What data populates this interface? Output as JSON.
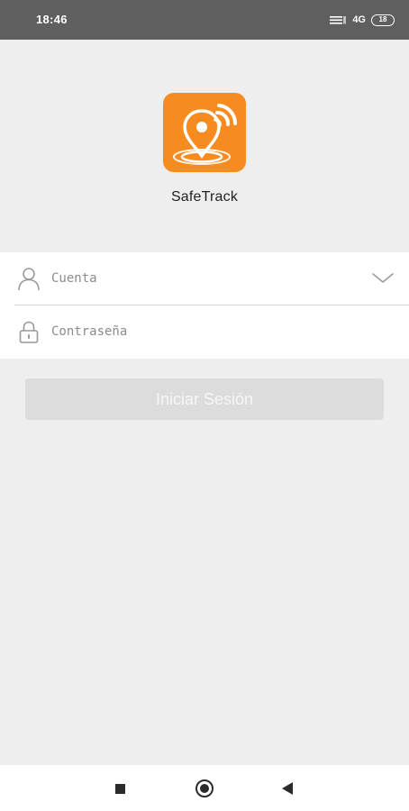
{
  "status_bar": {
    "time": "18:46",
    "network": "4G",
    "battery": "18"
  },
  "app": {
    "name": "SafeTrack",
    "logo_icon": "location-pin-signal-icon",
    "brand_color": "#f68b1f"
  },
  "login_form": {
    "account": {
      "placeholder": "Cuenta",
      "value": "",
      "icon": "user-icon",
      "dropdown_icon": "chevron-down-icon"
    },
    "password": {
      "placeholder": "Contraseña",
      "value": "",
      "icon": "lock-icon"
    },
    "submit_label": "Iniciar Sesión",
    "submit_enabled": false
  },
  "navigation": {
    "recent_icon": "square-icon",
    "home_icon": "circle-icon",
    "back_icon": "triangle-back-icon"
  }
}
